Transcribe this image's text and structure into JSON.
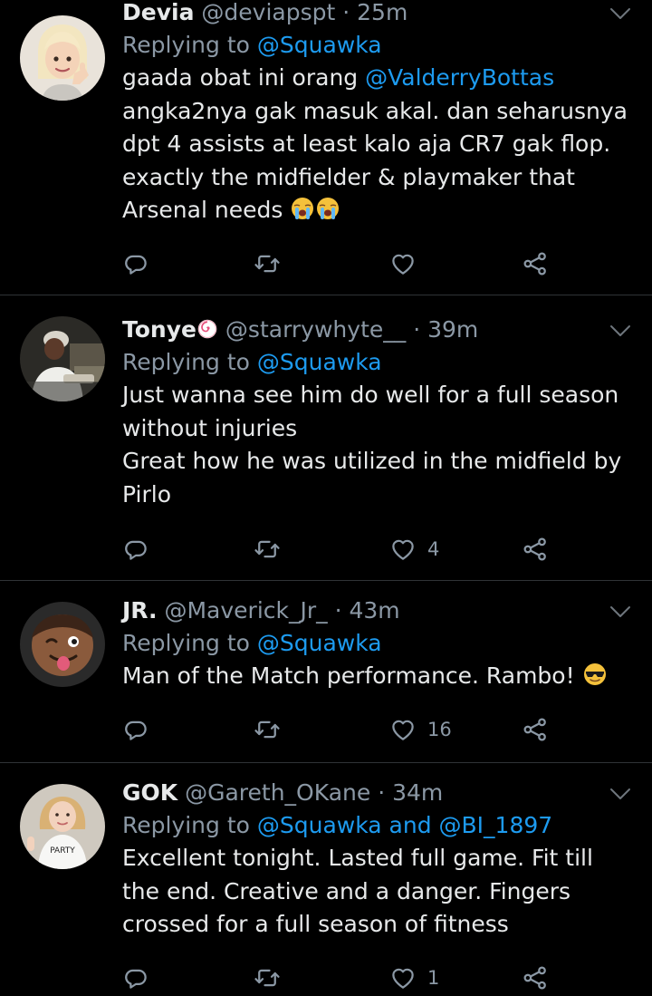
{
  "tweets": [
    {
      "name": "Devia",
      "handle": "@deviapspt",
      "time": "· 25m",
      "replying_prefix": "Replying to ",
      "replying_to": "@Squawka",
      "body_pre": "gaada obat ini orang ",
      "body_mention": "@ValderryBottas",
      "body_post": " angka2nya gak masuk akal. dan seharusnya dpt 4 assists at least kalo aja CR7 gak flop. exactly the midfielder & playmaker that Arsenal needs",
      "body_emoji": "loudly-crying-face x2",
      "likes": ""
    },
    {
      "name": "Tonye",
      "name_emoji": "fish-cake-emoji",
      "handle": "@starrywhyte__",
      "time": "· 39m",
      "replying_prefix": "Replying to ",
      "replying_to": "@Squawka",
      "body_line1": "Just wanna see him do well for a full season without injuries",
      "body_line2": "Great how he was utilized in the midfield by Pirlo",
      "likes": "4"
    },
    {
      "name": "JR.",
      "handle": "@Maverick_Jr_",
      "time": "· 43m",
      "replying_prefix": "Replying to ",
      "replying_to": "@Squawka",
      "body": "Man of the Match performance. Rambo!",
      "body_emoji": "smiling-face-with-sunglasses",
      "likes": "16"
    },
    {
      "name": "GOK",
      "handle": "@Gareth_OKane",
      "time": "· 34m",
      "replying_prefix": "Replying to ",
      "replying_to": "@Squawka and @BI_1897",
      "body": "Excellent tonight. Lasted full game. Fit till the end. Creative and a danger. Fingers crossed for a full season of fitness",
      "likes": "1"
    }
  ],
  "colors": {
    "background": "#000000",
    "link": "#1d9bf0",
    "secondary": "#8b98a5",
    "primary_text": "#e7e9ea",
    "divider": "#2f3336"
  }
}
